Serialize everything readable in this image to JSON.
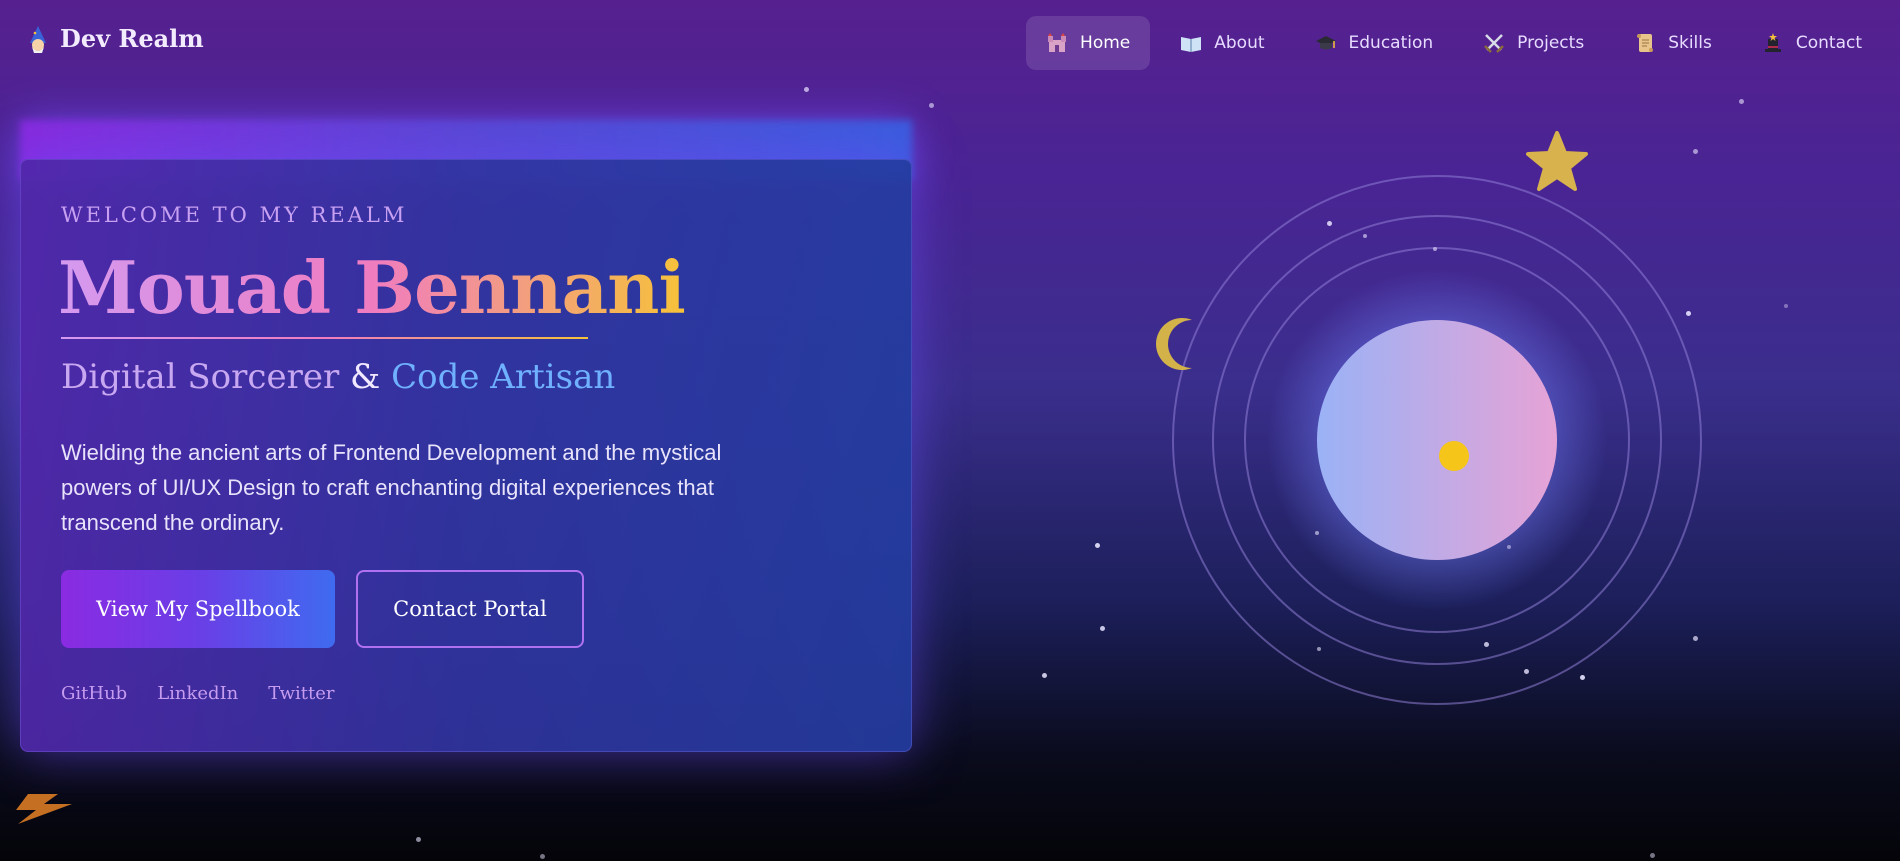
{
  "brand": {
    "title": "Dev Realm",
    "icon": "wizard-icon"
  },
  "nav": [
    {
      "label": "Home",
      "icon": "castle-icon",
      "active": true
    },
    {
      "label": "About",
      "icon": "open-book-icon",
      "active": false
    },
    {
      "label": "Education",
      "icon": "graduation-cap-icon",
      "active": false
    },
    {
      "label": "Projects",
      "icon": "crossed-swords-icon",
      "active": false
    },
    {
      "label": "Skills",
      "icon": "scroll-icon",
      "active": false
    },
    {
      "label": "Contact",
      "icon": "magic-hat-icon",
      "active": false
    }
  ],
  "hero": {
    "welcome": "WELCOME TO MY REALM",
    "name": "Mouad Bennani",
    "subtitle_a": "Digital Sorcerer",
    "subtitle_amp": "&",
    "subtitle_b": "Code Artisan",
    "description": "Wielding the ancient arts of Frontend Development and the mystical powers of UI/UX Design to craft enchanting digital experiences that transcend the ordinary.",
    "primary_button": "View My Spellbook",
    "secondary_button": "Contact Portal",
    "socials": [
      "GitHub",
      "LinkedIn",
      "Twitter"
    ]
  },
  "colors": {
    "accent_purple": "#8a2be2",
    "accent_blue": "#3f6bf0",
    "gold": "#f6c239",
    "pink": "#f07cc0"
  },
  "decor": {
    "icons": [
      "crescent-moon-icon",
      "star-icon",
      "lightning-bolt-icon",
      "orb-icon"
    ]
  }
}
